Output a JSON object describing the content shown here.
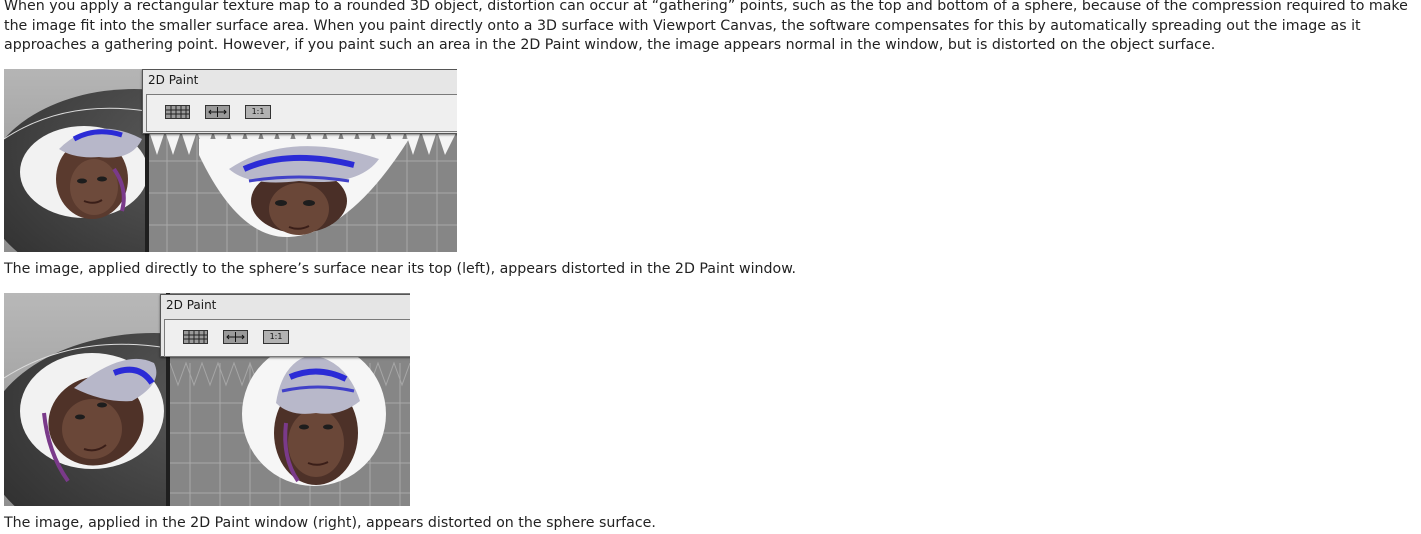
{
  "intro_paragraph": "When you apply a rectangular texture map to a rounded 3D object, distortion can occur at “gathering” points, such as the top and bottom of a sphere, because of the compression required to make the image fit into the smaller surface area. When you paint directly onto a 3D surface with Viewport Canvas, the software compensates for this by automatically spreading out the image as it approaches a gathering point. However, if you paint such an area in the 2D Paint window, the image appears normal in the window, but is distorted on the object surface.",
  "figures": [
    {
      "window_title": "2D Paint",
      "toolbar": {
        "grid_icon": "grid-icon",
        "fit_icon": "fit-arrows-icon",
        "ratio_label": "1:1"
      },
      "caption": "The image, applied directly to the sphere’s surface near its top (left), appears distorted in the 2D Paint window."
    },
    {
      "window_title": "2D Paint",
      "toolbar": {
        "grid_icon": "grid-icon",
        "fit_icon": "fit-arrows-icon",
        "ratio_label": "1:1"
      },
      "caption": "The image, applied in the 2D Paint window (right), appears distorted on the sphere surface."
    }
  ],
  "colors": {
    "text": "#222222",
    "viewport_gray": "#8a8a8a",
    "window_chrome": "#e6e6e6",
    "hat_blue": "#2b2bd6",
    "hair_purple": "#7a3a8a",
    "skin": "#6b4a3a"
  }
}
